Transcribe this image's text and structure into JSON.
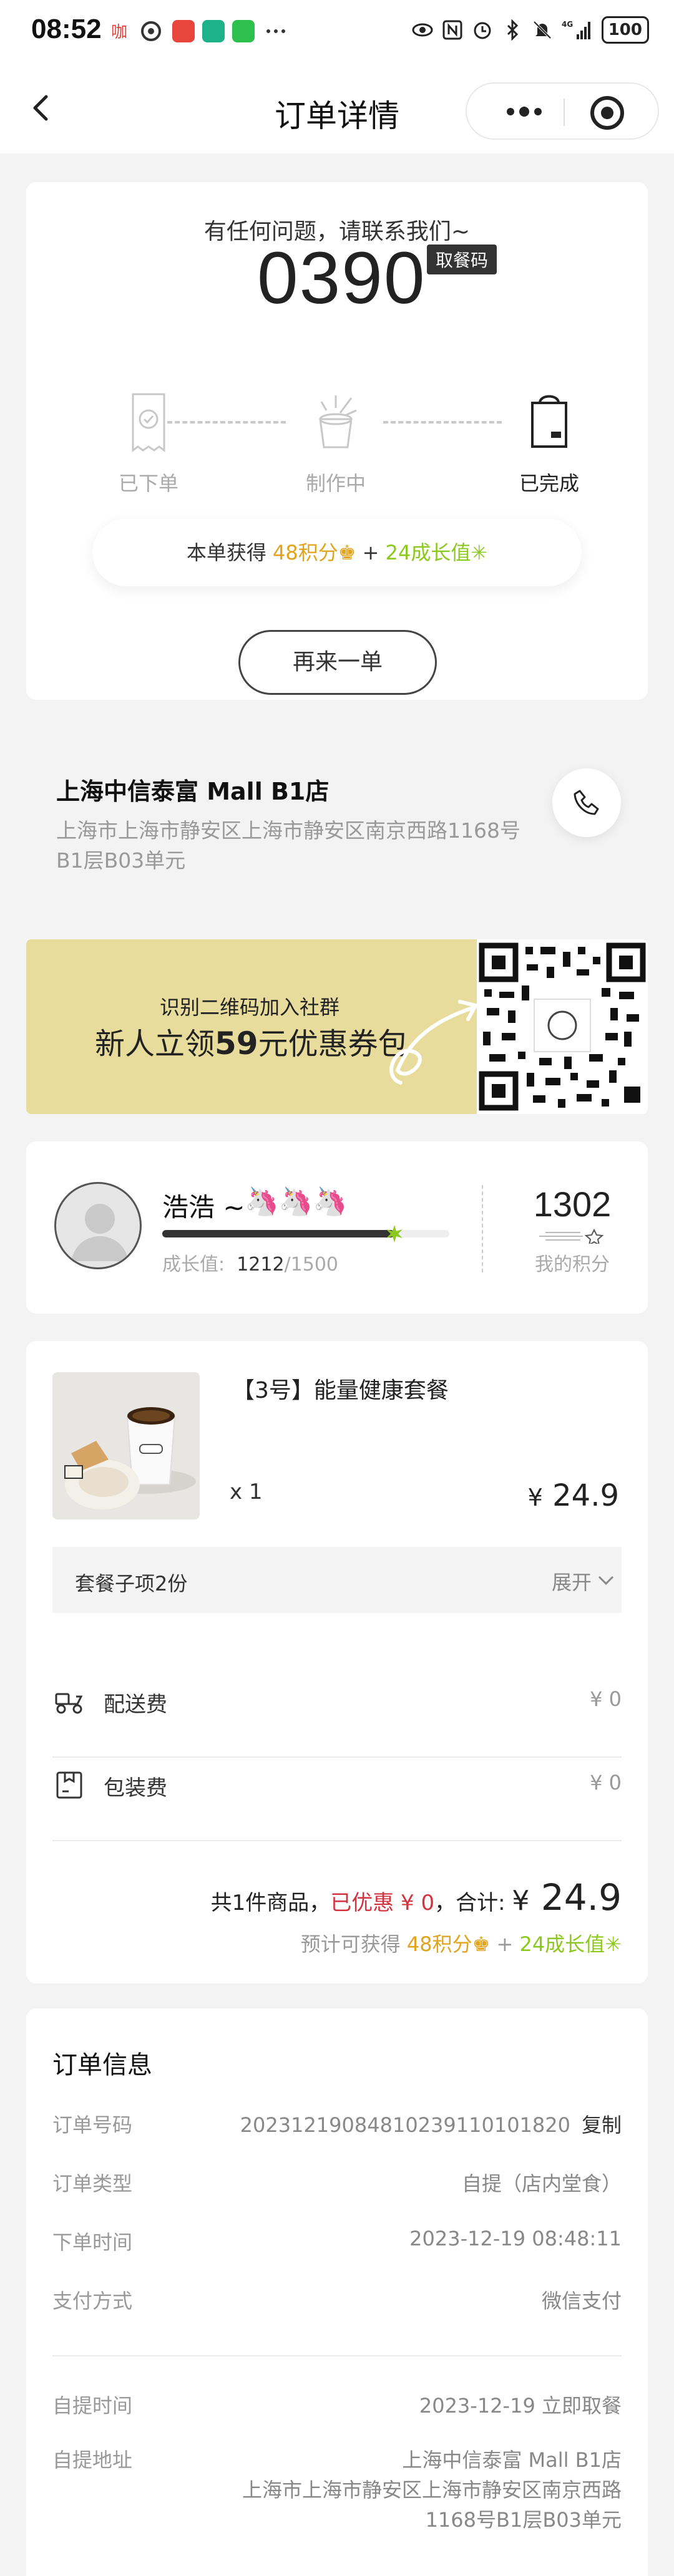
{
  "status_bar": {
    "time": "08:52",
    "signal_label": "4G",
    "battery": "100"
  },
  "nav": {
    "title": "订单详情"
  },
  "pickup": {
    "help_text": "有任何问题，请联系我们~",
    "code": "0390",
    "code_badge": "取餐码",
    "steps": [
      {
        "label": "已下单",
        "state": "inactive"
      },
      {
        "label": "制作中",
        "state": "inactive"
      },
      {
        "label": "已完成",
        "state": "active"
      }
    ],
    "reward_prefix": "本单获得",
    "reward_points": "48积分",
    "reward_plus": "+",
    "reward_growth": "24成长值",
    "reorder_label": "再来一单"
  },
  "store": {
    "name": "上海中信泰富 Mall B1店",
    "address": "上海市上海市静安区上海市静安区南京西路1168号B1层B03单元"
  },
  "banner": {
    "line1": "识别二维码加入社群",
    "line2_prefix": "新人立领",
    "line2_amount": "59",
    "line2_suffix": "元优惠券包"
  },
  "member": {
    "name": "浩浩 ~",
    "badges": "🦄🦄🦄",
    "growth_label": "成长值:",
    "growth_current": "1212",
    "growth_total": "/1500",
    "growth_progress": 0.808,
    "points": "1302",
    "points_label": "我的积分"
  },
  "order_items": {
    "product_name": "【3号】能量健康套餐",
    "quantity": "x 1",
    "price_symbol": "¥",
    "price": "24.9",
    "combo_label": "套餐子项2份",
    "combo_expand": "展开",
    "fees": [
      {
        "label": "配送费",
        "value": "¥ 0",
        "icon": "scooter-icon"
      },
      {
        "label": "包装费",
        "value": "¥ 0",
        "icon": "package-icon"
      }
    ],
    "total_count": "共1件商品，",
    "total_discount": "已优惠 ¥ 0",
    "total_sum_label": "，合计:",
    "total_symbol": "¥",
    "total_amount": "24.9",
    "expect_prefix": "预计可获得",
    "expect_points": "48积分",
    "expect_plus": "+",
    "expect_growth": "24成长值"
  },
  "order_info": {
    "title": "订单信息",
    "rows": [
      {
        "key": "订单号码",
        "value": "20231219084810239110101820",
        "action": "复制"
      },
      {
        "key": "订单类型",
        "value": "自提（店内堂食）"
      },
      {
        "key": "下单时间",
        "value": "2023-12-19 08:48:11"
      },
      {
        "key": "支付方式",
        "value": "微信支付"
      }
    ],
    "pickup_rows": [
      {
        "key": "自提时间",
        "value": "2023-12-19 立即取餐"
      },
      {
        "key": "自提地址",
        "value_line1": "上海中信泰富 Mall B1店",
        "value_line2": "上海市上海市静安区上海市静安区南京西路",
        "value_line3": "1168号B1层B03单元"
      }
    ]
  },
  "colors": {
    "gold": "#e0a41e",
    "green": "#8cc81e",
    "discount_red": "#d2333e",
    "banner_bg": "#e7dc9b"
  }
}
